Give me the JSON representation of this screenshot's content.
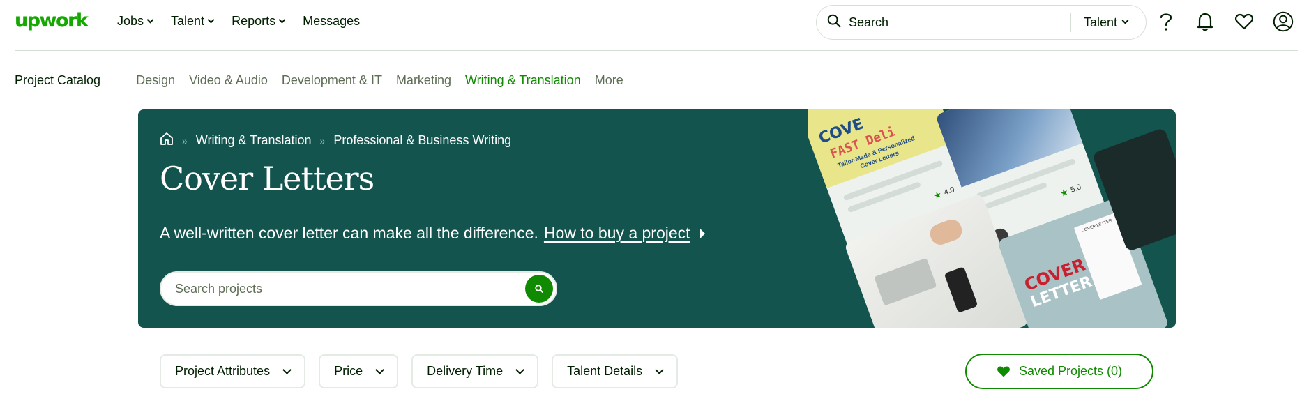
{
  "brand": {
    "logo_text": "upwork",
    "color": "#14a800"
  },
  "nav": {
    "items": [
      {
        "label": "Jobs",
        "has_dropdown": true
      },
      {
        "label": "Talent",
        "has_dropdown": true
      },
      {
        "label": "Reports",
        "has_dropdown": true
      },
      {
        "label": "Messages",
        "has_dropdown": false
      }
    ],
    "search": {
      "label": "Search",
      "type_selector": "Talent"
    },
    "icons": [
      "help-icon",
      "bell-icon",
      "heart-icon",
      "user-avatar-icon"
    ]
  },
  "catalog": {
    "title": "Project Catalog",
    "categories": [
      {
        "label": "Design",
        "active": false
      },
      {
        "label": "Video & Audio",
        "active": false
      },
      {
        "label": "Development & IT",
        "active": false
      },
      {
        "label": "Marketing",
        "active": false
      },
      {
        "label": "Writing & Translation",
        "active": true
      },
      {
        "label": "More",
        "active": false
      }
    ]
  },
  "hero": {
    "breadcrumb": [
      "Writing & Translation",
      "Professional & Business Writing"
    ],
    "title": "Cover Letters",
    "description": "A well-written cover letter can make all the difference.",
    "link_text": "How to buy a project",
    "search_placeholder": "Search projects",
    "background_color": "#13544e",
    "collage": {
      "card1_top": "COVE",
      "card1_mid": "FAST Deli",
      "card1_sub": "Tailor-Made & Personalized",
      "card1_sub2": "Cover Letters",
      "card1_rating": "4.9",
      "card2_rating": "5.0",
      "card3_title": "COVER",
      "card3_title2": "LETTER",
      "card3_doc": "COVER LETTER"
    }
  },
  "filters": {
    "items": [
      "Project Attributes",
      "Price",
      "Delivery Time",
      "Talent Details"
    ],
    "saved_label": "Saved Projects (0)"
  }
}
